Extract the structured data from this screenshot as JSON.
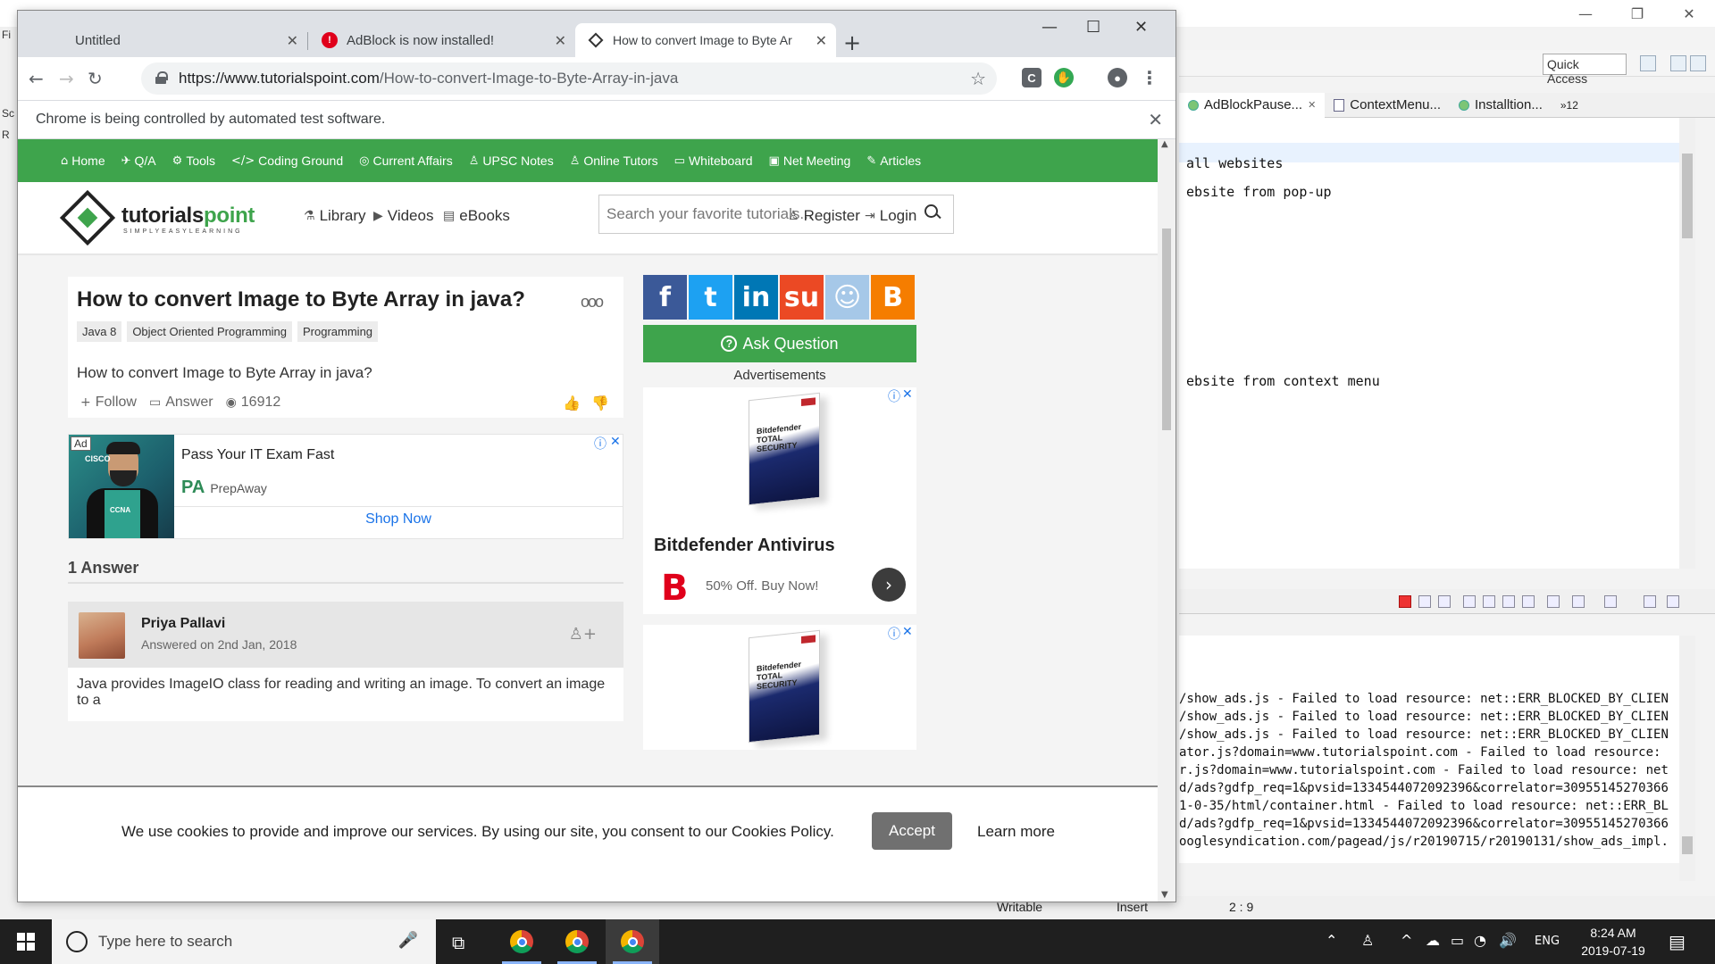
{
  "ide": {
    "quick_access": "Quick Access",
    "tabs": [
      {
        "label": "AdBlockPause...",
        "close": "✕"
      },
      {
        "label": "ContextMenu..."
      },
      {
        "label": "Installtion..."
      },
      {
        "label": "»12"
      }
    ],
    "editor_lines": [
      "all websites",
      "ebsite from pop-up",
      "ebsite from context menu"
    ],
    "console_lines": [
      "/show_ads.js - Failed to load resource: net::ERR_BLOCKED_BY_CLIEN",
      "/show_ads.js - Failed to load resource: net::ERR_BLOCKED_BY_CLIEN",
      "/show_ads.js - Failed to load resource: net::ERR_BLOCKED_BY_CLIEN",
      "ator.js?domain=www.tutorialspoint.com - Failed to load resource:",
      "r.js?domain=www.tutorialspoint.com - Failed to load resource: net",
      "d/ads?gdfp_req=1&pvsid=1334544072092396&correlator=30955145270366",
      "1-0-35/html/container.html - Failed to load resource: net::ERR_BL",
      "d/ads?gdfp_req=1&pvsid=1334544072092396&correlator=30955145270366",
      "ooglesyndication.com/pagead/js/r20190715/r20190131/show_ads_impl."
    ],
    "status": {
      "writable": "Writable",
      "insert": "Insert",
      "position": "2 : 9"
    },
    "left_strip": [
      "Fi",
      "Sc",
      "R"
    ]
  },
  "browser": {
    "tabs": [
      {
        "title": "Untitled",
        "close": "✕"
      },
      {
        "title": "AdBlock is now installed!",
        "close": "✕"
      },
      {
        "title": "How to convert Image to Byte Ar",
        "close": "✕"
      }
    ],
    "new_tab": "+",
    "window_controls": {
      "minimize": "—",
      "maximize": "☐",
      "close": "✕"
    },
    "url_host": "https://www.tutorialspoint.com",
    "url_path": "/How-to-convert-Image-to-Byte-Array-in-java",
    "extension_c": "C",
    "infobar": "Chrome is being controlled by automated test software."
  },
  "site": {
    "nav": [
      {
        "icon": "⌂",
        "label": "Home"
      },
      {
        "icon": "✈",
        "label": "Q/A"
      },
      {
        "icon": "⚙",
        "label": "Tools"
      },
      {
        "icon": "</>",
        "label": "Coding Ground"
      },
      {
        "icon": "◎",
        "label": "Current Affairs"
      },
      {
        "icon": "♙",
        "label": "UPSC Notes"
      },
      {
        "icon": "♙",
        "label": "Online Tutors"
      },
      {
        "icon": "▭",
        "label": "Whiteboard"
      },
      {
        "icon": "▣",
        "label": "Net Meeting"
      },
      {
        "icon": "✎",
        "label": "Articles"
      }
    ],
    "logo": {
      "name_a": "tutorials",
      "name_b": "point",
      "tagline": "SIMPLYEASYLEARNING"
    },
    "header_links": [
      {
        "icon": "⚗",
        "label": "Library"
      },
      {
        "icon": "▶",
        "label": "Videos"
      },
      {
        "icon": "▤",
        "label": "eBooks"
      }
    ],
    "search_placeholder": "Search your favorite tutorials...",
    "register": "Register",
    "login": "Login",
    "question": {
      "title": "How to convert Image to Byte Array in java?",
      "more": "ooo",
      "tags": [
        "Java 8",
        "Object Oriented Programming",
        "Programming"
      ],
      "text": "How to convert Image to Byte Array in java?",
      "follow": "Follow",
      "answer": "Answer",
      "views": "16912"
    },
    "ad1": {
      "badge": "Ad",
      "brand_logo": "CISCO",
      "cert": "CCNA",
      "title": "Pass Your IT Exam Fast",
      "brand": "PrepAway",
      "cta": "Shop Now"
    },
    "answers_heading": "1 Answer",
    "answerer": {
      "name": "Priya Pallavi",
      "date": "Answered on 2nd Jan, 2018"
    },
    "answer_text": "Java provides ImageIO class for reading and writing an image. To convert an image to a",
    "social": [
      {
        "label": "f",
        "color": "#3b5998"
      },
      {
        "label": "t",
        "color": "#1da1f2"
      },
      {
        "label": "in",
        "color": "#0077b5"
      },
      {
        "label": "su",
        "color": "#eb4924"
      },
      {
        "label": "☺",
        "color": "#a6c8e8"
      },
      {
        "label": "B",
        "color": "#f57d00"
      }
    ],
    "ask_question": "Ask Question",
    "ads_label": "Advertisements",
    "ad2": {
      "box_text": "Bitdefender TOTAL SECURITY",
      "title": "Bitdefender Antivirus",
      "logo": "B",
      "offer": "50% Off. Buy Now!"
    },
    "cookie": {
      "message": "We use cookies to provide and improve our services. By using our site, you consent to our Cookies Policy.",
      "accept": "Accept",
      "learn_more": "Learn more"
    }
  },
  "taskbar": {
    "search_placeholder": "Type here to search",
    "language": "ENG",
    "time": "8:24 AM",
    "date": "2019-07-19"
  }
}
